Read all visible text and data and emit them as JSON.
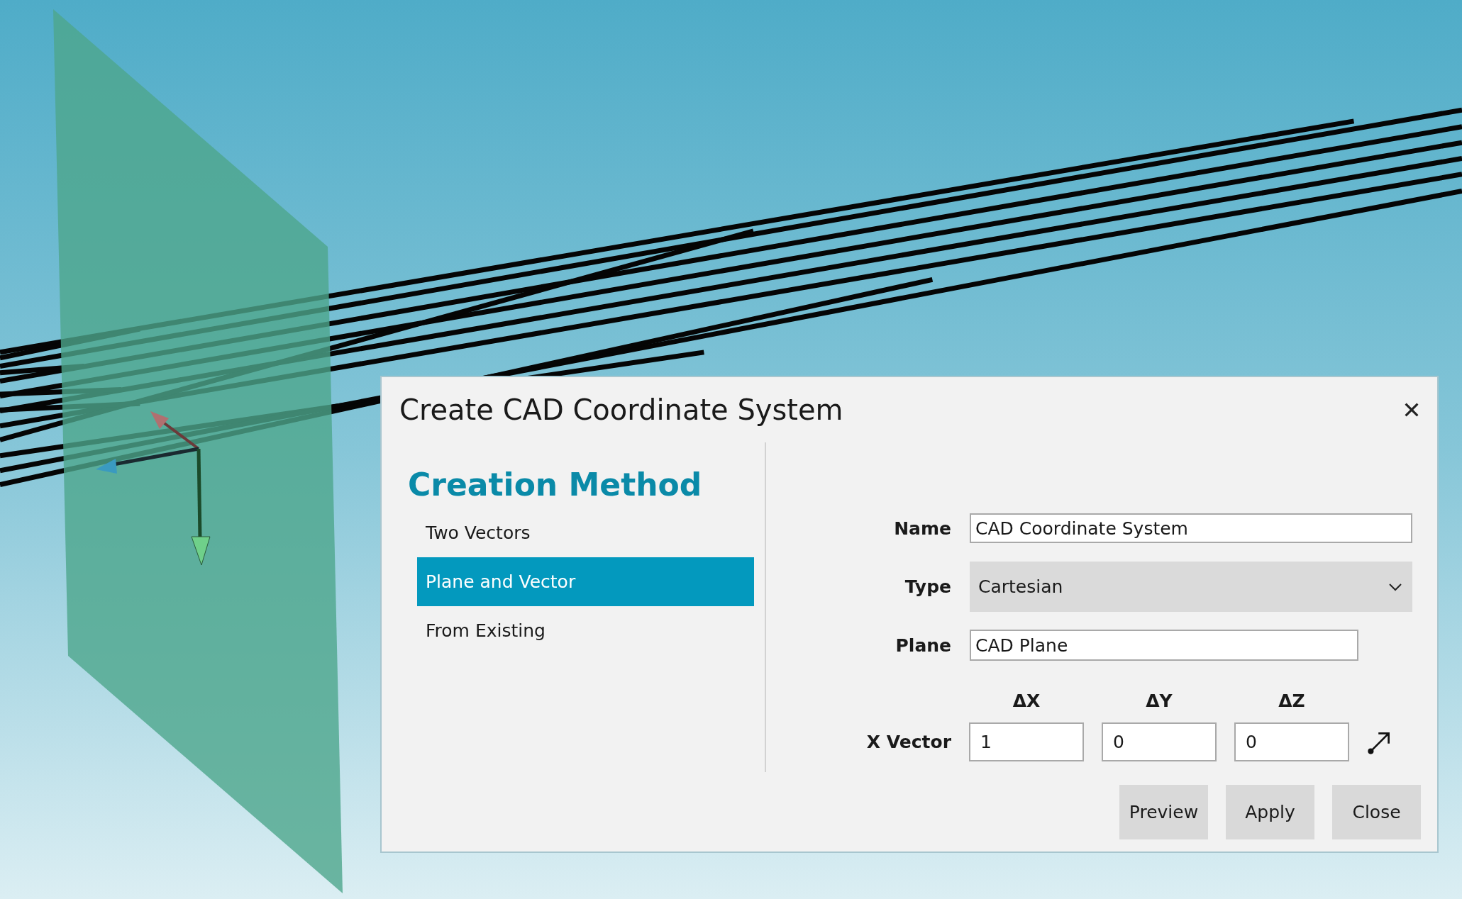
{
  "dialog": {
    "title": "Create CAD Coordinate System",
    "method_heading": "Creation Method",
    "methods": [
      {
        "label": "Two Vectors",
        "selected": false
      },
      {
        "label": "Plane and Vector",
        "selected": true
      },
      {
        "label": "From Existing",
        "selected": false
      }
    ],
    "fields": [
      {
        "kind": "text",
        "label": "Name",
        "value": "CAD Coordinate System"
      },
      {
        "kind": "dropdown",
        "label": "Type",
        "value": "Cartesian"
      },
      {
        "kind": "short_text",
        "label": "Plane",
        "value": "CAD Plane"
      },
      {
        "kind": "vector",
        "label": "X Vector",
        "components": [
          {
            "header": "ΔX",
            "value": "1"
          },
          {
            "header": "ΔY",
            "value": "0"
          },
          {
            "header": "ΔZ",
            "value": "0"
          }
        ]
      }
    ],
    "buttons": [
      "Preview",
      "Apply",
      "Close"
    ]
  }
}
